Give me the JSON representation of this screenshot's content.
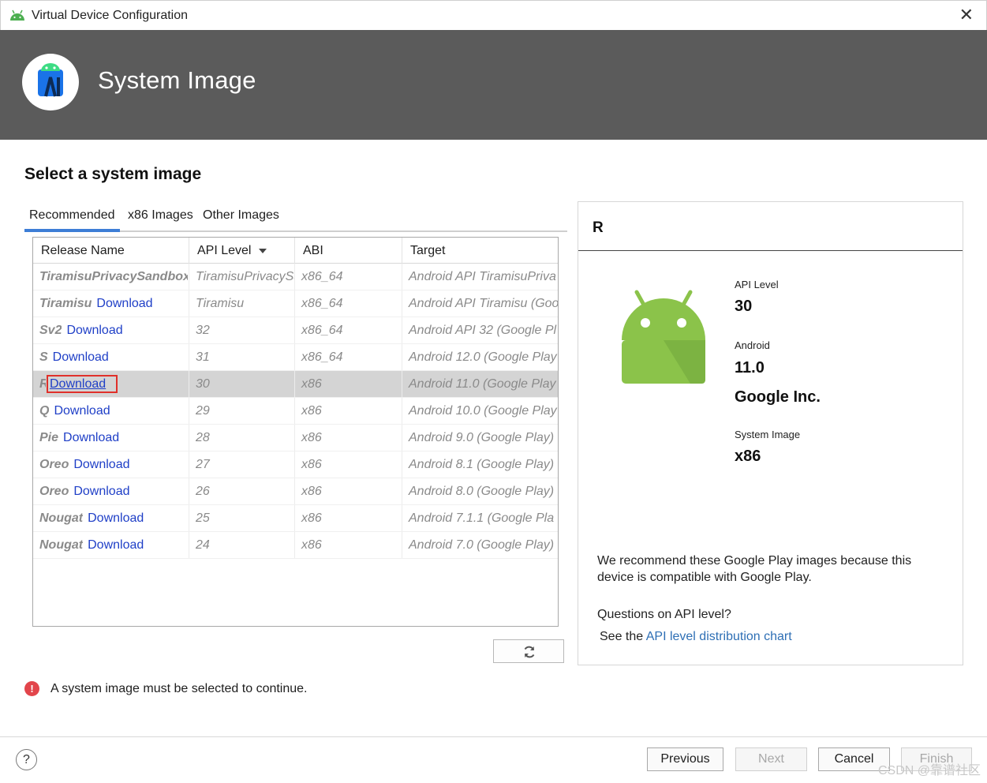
{
  "window": {
    "title": "Virtual Device Configuration",
    "close_glyph": "✕"
  },
  "header": {
    "title": "System Image"
  },
  "page": {
    "section_title": "Select a system image"
  },
  "tabs": [
    {
      "label": "Recommended",
      "active": true
    },
    {
      "label": "x86 Images",
      "active": false
    },
    {
      "label": "Other Images",
      "active": false
    }
  ],
  "table": {
    "columns": [
      "Release Name",
      "API Level",
      "ABI",
      "Target"
    ],
    "sort_column": "API Level",
    "rows": [
      {
        "name": "TiramisuPrivacySandbox",
        "download": "",
        "api": "TiramisuPrivacySa",
        "abi": "x86_64",
        "target": "Android API TiramisuPriva"
      },
      {
        "name": "Tiramisu",
        "download": "Download",
        "api": "Tiramisu",
        "abi": "x86_64",
        "target": "Android API Tiramisu (Goo"
      },
      {
        "name": "Sv2",
        "download": "Download",
        "api": "32",
        "abi": "x86_64",
        "target": "Android API 32 (Google Pl"
      },
      {
        "name": "S",
        "download": "Download",
        "api": "31",
        "abi": "x86_64",
        "target": "Android 12.0 (Google Play"
      },
      {
        "name": "R",
        "download": "Download",
        "api": "30",
        "abi": "x86",
        "target": "Android 11.0 (Google Play",
        "selected": true
      },
      {
        "name": "Q",
        "download": "Download",
        "api": "29",
        "abi": "x86",
        "target": "Android 10.0 (Google Play"
      },
      {
        "name": "Pie",
        "download": "Download",
        "api": "28",
        "abi": "x86",
        "target": "Android 9.0 (Google Play)"
      },
      {
        "name": "Oreo",
        "download": "Download",
        "api": "27",
        "abi": "x86",
        "target": "Android 8.1 (Google Play)"
      },
      {
        "name": "Oreo",
        "download": "Download",
        "api": "26",
        "abi": "x86",
        "target": "Android 8.0 (Google Play)"
      },
      {
        "name": "Nougat",
        "download": "Download",
        "api": "25",
        "abi": "x86",
        "target": "Android 7.1.1 (Google Pla"
      },
      {
        "name": "Nougat",
        "download": "Download",
        "api": "24",
        "abi": "x86",
        "target": "Android 7.0 (Google Play)"
      }
    ]
  },
  "detail": {
    "title": "R",
    "api_level_label": "API Level",
    "api_level_value": "30",
    "android_label": "Android",
    "android_value": "11.0",
    "vendor": "Google Inc.",
    "system_image_label": "System Image",
    "system_image_value": "x86",
    "recommend_text": "We recommend these Google Play images because this device is compatible with Google Play.",
    "question": "Questions on API level?",
    "see_prefix": "See the ",
    "see_link": "API level distribution chart"
  },
  "error": {
    "message": "A system image must be selected to continue."
  },
  "footer": {
    "help_glyph": "?",
    "previous": "Previous",
    "next": "Next",
    "cancel": "Cancel",
    "finish": "Finish",
    "watermark": "CSDN @靠谱社区"
  },
  "colors": {
    "header_bg": "#5b5b5b",
    "accent": "#3d7ed6",
    "link": "#1f3fc7",
    "error": "#e2454b",
    "android_green": "#8bc34a"
  },
  "icons": [
    "android-icon",
    "android-studio-logo-icon",
    "close-icon",
    "refresh-icon",
    "error-icon",
    "help-icon",
    "sort-desc-icon"
  ]
}
